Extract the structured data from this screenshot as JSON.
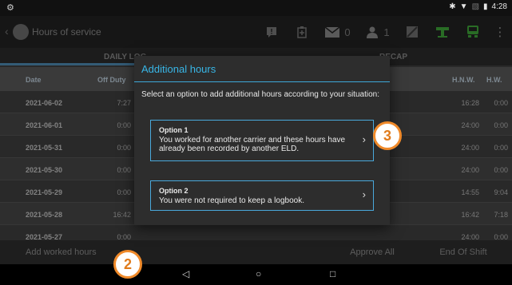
{
  "status_bar": {
    "time": "4:28"
  },
  "app_bar": {
    "title": "Hours of service",
    "mail_count": "0",
    "person_count": "1"
  },
  "tabs": {
    "daily_log": "DAILY LOG",
    "recap": "RECAP"
  },
  "table": {
    "headers": {
      "date": "Date",
      "off_duty": "Off Duty",
      "hnw": "H.N.W.",
      "hw": "H.W."
    },
    "rows": [
      {
        "date": "2021-06-02",
        "off_duty": "7:27",
        "hnw": "16:28",
        "hw": "0:00"
      },
      {
        "date": "2021-06-01",
        "off_duty": "0:00",
        "hnw": "24:00",
        "hw": "0:00"
      },
      {
        "date": "2021-05-31",
        "off_duty": "0:00",
        "hnw": "24:00",
        "hw": "0:00"
      },
      {
        "date": "2021-05-30",
        "off_duty": "0:00",
        "hnw": "24:00",
        "hw": "0:00"
      },
      {
        "date": "2021-05-29",
        "off_duty": "0:00",
        "hnw": "14:55",
        "hw": "9:04"
      },
      {
        "date": "2021-05-28",
        "off_duty": "16:42",
        "hnw": "16:42",
        "hw": "7:18"
      },
      {
        "date": "2021-05-27",
        "off_duty": "0:00",
        "hnw": "24:00",
        "hw": "0:00"
      }
    ]
  },
  "bottom_bar": {
    "add_hours": "Add worked hours",
    "approve_all": "Approve All",
    "end_of_shift": "End Of Shift"
  },
  "dialog": {
    "title": "Additional hours",
    "prompt": "Select an option to add additional hours according to your situation:",
    "options": [
      {
        "title": "Option 1",
        "description": "You worked for another carrier and these hours have already been recorded by another ELD."
      },
      {
        "title": "Option 2",
        "description": "You were not required to keep a logbook."
      }
    ]
  },
  "callouts": {
    "first": "2",
    "second": "3"
  },
  "colors": {
    "accent": "#38b6e6",
    "callout": "#f08a2a",
    "truck_green": "#3fa73a"
  }
}
